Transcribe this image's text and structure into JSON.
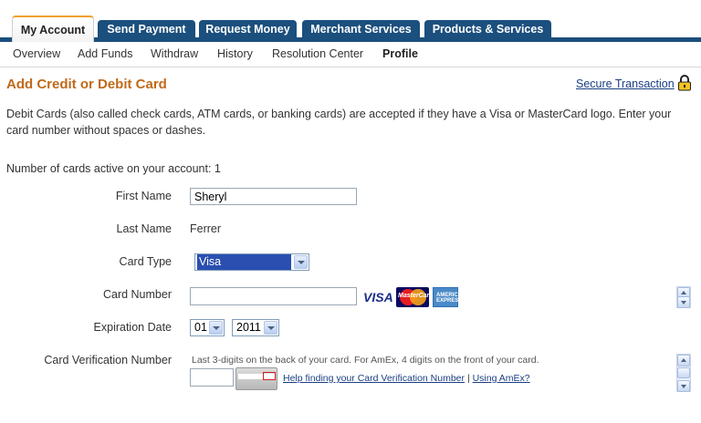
{
  "tabs": [
    {
      "label": "My Account",
      "active": true
    },
    {
      "label": "Send Payment"
    },
    {
      "label": "Request Money"
    },
    {
      "label": "Merchant Services"
    },
    {
      "label": "Products & Services"
    }
  ],
  "subnav": [
    "Overview",
    "Add Funds",
    "Withdraw",
    "History",
    "Resolution Center",
    "Profile"
  ],
  "page": {
    "title": "Add Credit or Debit Card",
    "secure_link": "Secure Transaction",
    "description": "Debit Cards (also called check cards, ATM cards, or banking cards) are accepted if they have a Visa or MasterCard logo. Enter your card number without spaces or dashes.",
    "cards_active": "Number of cards active on your account: 1"
  },
  "form": {
    "first_name_label": "First Name",
    "first_name_value": "Sheryl",
    "last_name_label": "Last Name",
    "last_name_value": "Ferrer",
    "card_type_label": "Card Type",
    "card_type_value": "Visa",
    "card_number_label": "Card Number",
    "card_number_value": "",
    "expiration_label": "Expiration Date",
    "exp_month": "01",
    "exp_year": "2011",
    "cvv_label": "Card Verification Number",
    "cvv_hint": "Last 3-digits on the back of your card. For AmEx, 4 digits on the front of your card.",
    "cvv_help_link": "Help finding your Card Verification Number",
    "cvv_separator": "|",
    "cvv_amex_link": "Using AmEx?",
    "card_logos": {
      "visa": "VISA",
      "mastercard": "MasterCard",
      "amex": "AMERICAN EXPRESS"
    }
  },
  "colors": {
    "tab_bar": "#1b4f7d",
    "title": "#c06a1a",
    "link": "#1a3f82",
    "active_tab_accent": "#f0a030"
  }
}
